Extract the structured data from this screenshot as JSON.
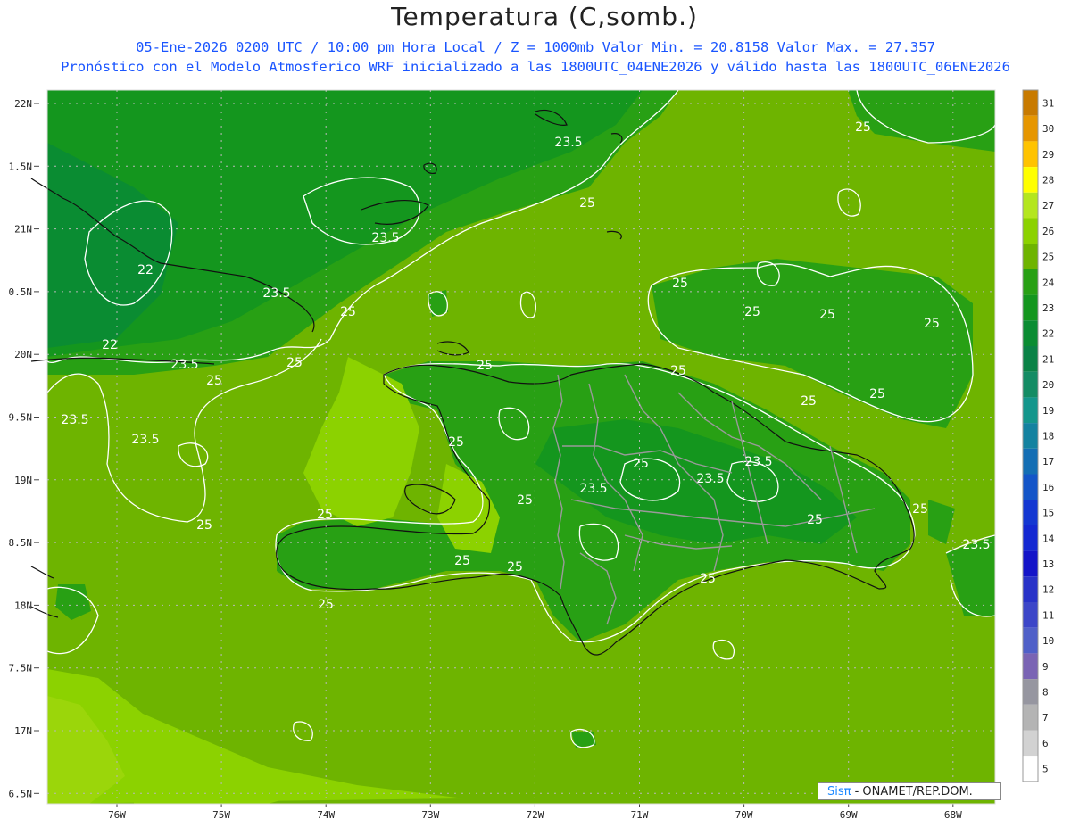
{
  "header": {
    "title": "Temperatura (C,somb.)",
    "subtitle_line1": "05-Ene-2026 0200 UTC / 10:00 pm Hora Local / Z = 1000mb   Valor Min. = 20.8158  Valor Max. = 27.357",
    "subtitle_line2": "Pronóstico con el Modelo Atmosferico WRF inicializado a las 1800UTC_04ENE2026 y válido hasta las  1800UTC_06ENE2026"
  },
  "axes": {
    "lon_labels": [
      "76W",
      "75W",
      "74W",
      "73W",
      "72W",
      "71W",
      "70W",
      "69W",
      "68W"
    ],
    "lat_labels": [
      "22N",
      "1.5N",
      "21N",
      "0.5N",
      "20N",
      "9.5N",
      "19N",
      "8.5N",
      "18N",
      "7.5N",
      "17N",
      "6.5N"
    ]
  },
  "colorbar": {
    "levels": [
      "31",
      "30",
      "29",
      "28",
      "27",
      "26",
      "25",
      "24",
      "23",
      "22",
      "21",
      "20",
      "19",
      "18",
      "17",
      "16",
      "15",
      "14",
      "13",
      "12",
      "11",
      "10",
      "9",
      "8",
      "7",
      "6",
      "5"
    ],
    "colors": [
      "#c87a00",
      "#e69600",
      "#ffc300",
      "#ffff00",
      "#b4e61e",
      "#8cd200",
      "#6eb400",
      "#28a014",
      "#14961e",
      "#0a8c32",
      "#0a8246",
      "#148c64",
      "#14968c",
      "#1482a0",
      "#146eb4",
      "#1455c8",
      "#1437d2",
      "#1428d2",
      "#1414c8",
      "#2832c8",
      "#3c46c8",
      "#5060c8",
      "#7a64b4",
      "#9696a0",
      "#b4b4b4",
      "#d2d2d2",
      "#ffffff"
    ]
  },
  "contour_labels": [
    {
      "text": "23.5"
    },
    {
      "text": "25"
    },
    {
      "text": "25"
    },
    {
      "text": "23.5"
    },
    {
      "text": "22"
    },
    {
      "text": "23.5"
    },
    {
      "text": "25"
    },
    {
      "text": "25"
    },
    {
      "text": "22"
    },
    {
      "text": "23.5"
    },
    {
      "text": "25"
    },
    {
      "text": "25"
    },
    {
      "text": "23.5"
    },
    {
      "text": "23.5"
    },
    {
      "text": "25"
    },
    {
      "text": "25"
    },
    {
      "text": "25"
    },
    {
      "text": "25"
    },
    {
      "text": "25"
    },
    {
      "text": "25"
    },
    {
      "text": "25"
    },
    {
      "text": "25"
    },
    {
      "text": "25"
    },
    {
      "text": "23.5"
    },
    {
      "text": "23.5"
    },
    {
      "text": "23.5"
    },
    {
      "text": "25"
    },
    {
      "text": "25"
    },
    {
      "text": "25"
    },
    {
      "text": "25"
    },
    {
      "text": "25"
    },
    {
      "text": "23.5"
    },
    {
      "text": "25"
    },
    {
      "text": "25"
    },
    {
      "text": "25"
    },
    {
      "text": "25"
    },
    {
      "text": "25"
    }
  ],
  "credit": {
    "logo": "Sisπ",
    "text": " - ONAMET/REP.DOM."
  }
}
